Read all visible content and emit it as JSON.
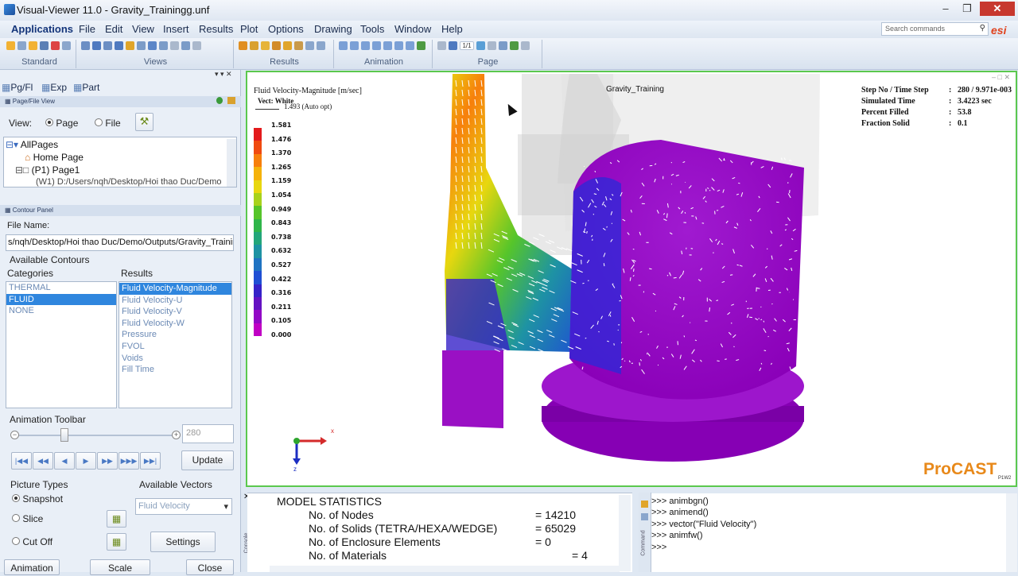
{
  "window": {
    "title": "Visual-Viewer 11.0 - Gravity_Trainingg.unf",
    "minimize": "–",
    "restore": "❐",
    "close": "✕"
  },
  "menu": {
    "items": [
      "Applications",
      "File",
      "Edit",
      "View",
      "Insert",
      "Results",
      "Plot",
      "Options",
      "Drawing",
      "Tools",
      "Window",
      "Help"
    ],
    "search_placeholder": "Search commands",
    "brand": "esi"
  },
  "toolbar": {
    "groups": [
      "Standard",
      "Views",
      "Results",
      "Animation",
      "Page"
    ],
    "page_value": "1/1"
  },
  "left_panel": {
    "tabs": [
      "Pg/Fl",
      "Exp",
      "Part"
    ],
    "page_file_view_title": "Page/File View",
    "view_label": "View:",
    "view_options": [
      "Page",
      "File"
    ],
    "tree": [
      "AllPages",
      "Home Page",
      "(P1) Page1",
      "(W1) D:/Users/nqh/Desktop/Hoi thao Duc/Demo"
    ],
    "contour_title": "Contour Panel",
    "file_name_label": "File Name:",
    "file_name_value": "s/nqh/Desktop/Hoi thao Duc/Demo/Outputs/Gravity_Training",
    "available_contours": "Available Contours",
    "categories_label": "Categories",
    "results_label": "Results",
    "categories": [
      "THERMAL",
      "FLUID",
      "NONE"
    ],
    "selected_category": "FLUID",
    "results": [
      "Fluid Velocity-Magnitude",
      "Fluid Velocity-U",
      "Fluid Velocity-V",
      "Fluid Velocity-W",
      "Pressure",
      "FVOL",
      "Voids",
      "Fill Time"
    ],
    "selected_result": "Fluid Velocity-Magnitude",
    "animation_toolbar": "Animation Toolbar",
    "step_value": "280",
    "update_button": "Update",
    "anim_buttons": [
      "|◀◀",
      "◀◀",
      "◀",
      "▶",
      "▶▶",
      "▶▶▶",
      "▶▶|"
    ],
    "picture_types": "Picture Types",
    "picture_options": [
      "Snapshot",
      "Slice",
      "Cut Off"
    ],
    "available_vectors": "Available Vectors",
    "vector_value": "Fluid Velocity",
    "settings_button": "Settings",
    "bottom_buttons": [
      "Animation",
      "Scale",
      "Close"
    ]
  },
  "viewport": {
    "legend_title": "Fluid Velocity-Magnitude [m/sec]",
    "vect_label": "Vect: White",
    "vect_value": "1.493  (Auto opt)",
    "legend_values": [
      "1.581",
      "1.476",
      "1.370",
      "1.265",
      "1.159",
      "1.054",
      "0.949",
      "0.843",
      "0.738",
      "0.632",
      "0.527",
      "0.422",
      "0.316",
      "0.211",
      "0.105",
      "0.000"
    ],
    "legend_colors": [
      "#e31a1c",
      "#f04a10",
      "#f77f0c",
      "#f5b20b",
      "#e8d70f",
      "#a8d21c",
      "#56c52a",
      "#2fb54a",
      "#23a67a",
      "#1e93a3",
      "#1f73c2",
      "#1f4fd4",
      "#3622c8",
      "#6412c2",
      "#9208c6",
      "#c000c4"
    ],
    "model_name": "Gravity_Training",
    "info": [
      {
        "label": "Step No / Time Step",
        "value": "280 / 9.971e-003"
      },
      {
        "label": "Simulated Time",
        "value": "3.4223 sec"
      },
      {
        "label": "Percent Filled",
        "value": "53.8"
      },
      {
        "label": "Fraction Solid",
        "value": "0.1"
      }
    ],
    "axis_x": "x",
    "axis_z": "z",
    "logo": "ProCAST",
    "logo_sub": "P1W2"
  },
  "console": {
    "strip_label": "Console",
    "heading": "MODEL   STATISTICS",
    "rows": [
      {
        "label": "No. of Nodes",
        "value": "= 14210"
      },
      {
        "label": "No. of Solids (TETRA/HEXA/WEDGE)",
        "value": "= 65029"
      },
      {
        "label": "No. of Enclosure Elements",
        "value": "= 0"
      },
      {
        "label": "No. of Materials",
        "value": "= 4"
      }
    ]
  },
  "command": {
    "strip_label": "Command",
    "lines": [
      ">>> animbgn()",
      ">>> animend()",
      ">>> vector(\"Fluid Velocity\")",
      ">>> animfw()",
      ">>>"
    ]
  }
}
